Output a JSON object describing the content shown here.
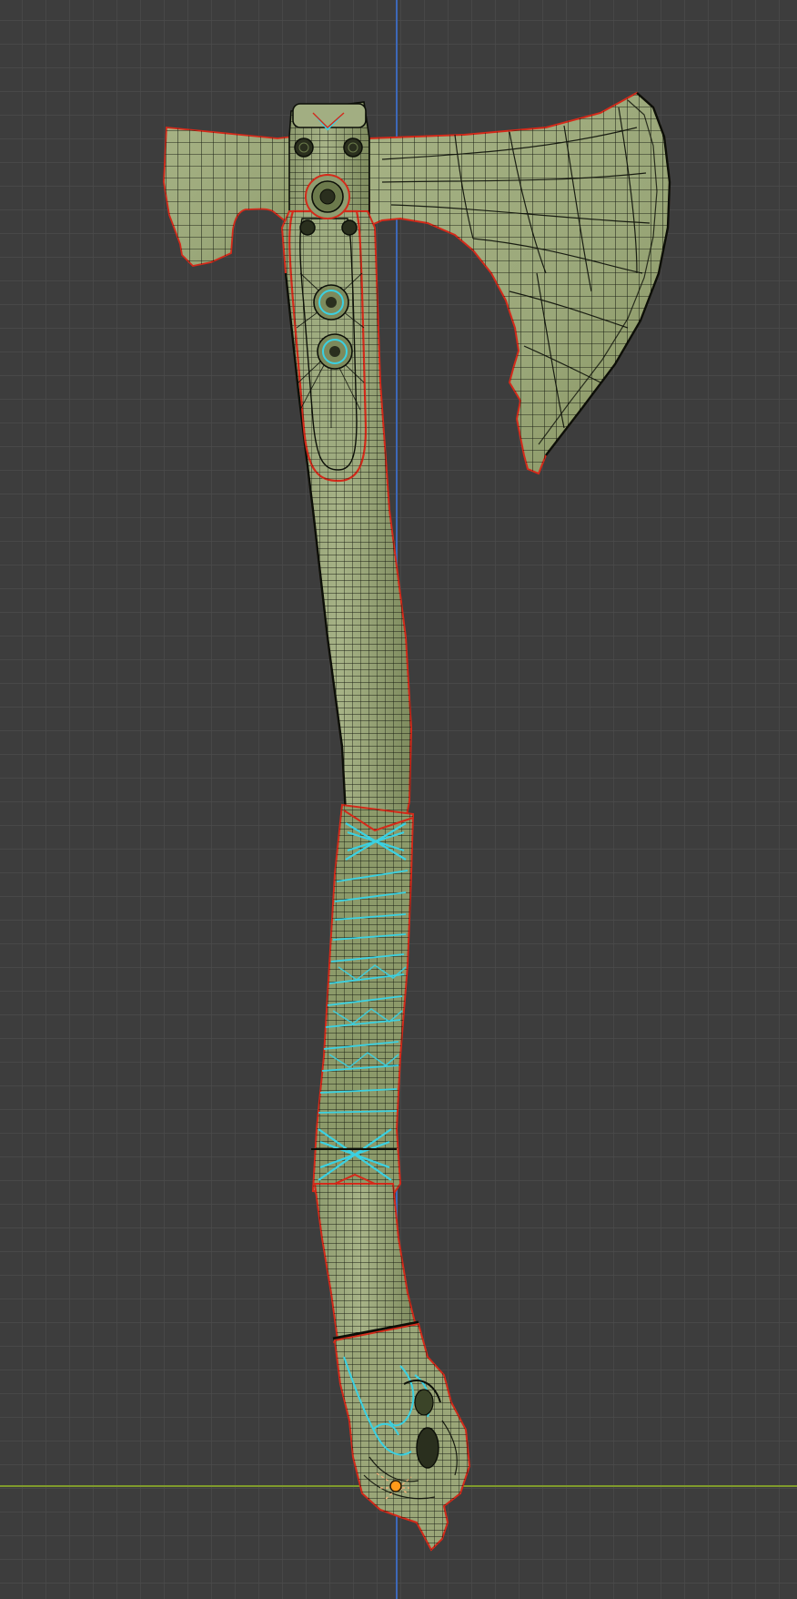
{
  "viewport": {
    "mode": "edit-mode-wireframe-overlay",
    "view": "front-orthographic",
    "object": "viking-axe-mesh",
    "grid": true
  },
  "colors": {
    "background": "#3d3d3d",
    "grid_minor": "#4a4a4a",
    "grid_major": "#565656",
    "axis_x": "#7f9a2c",
    "axis_z": "#3d68b8",
    "mesh_fill": "#9aa77b",
    "mesh_fill_shade": "#7f8c60",
    "wire": "#0c0f08",
    "seam": "#d42a1a",
    "selected_edges": "#3ad1e2",
    "origin": "#ff9a1a"
  },
  "icons": {
    "origin": "object-origin-icon",
    "axe_head": "axe-blade-shape",
    "handle": "handle-shape",
    "grip": "grip-wrap-shape",
    "pommel": "pommel-shape"
  }
}
